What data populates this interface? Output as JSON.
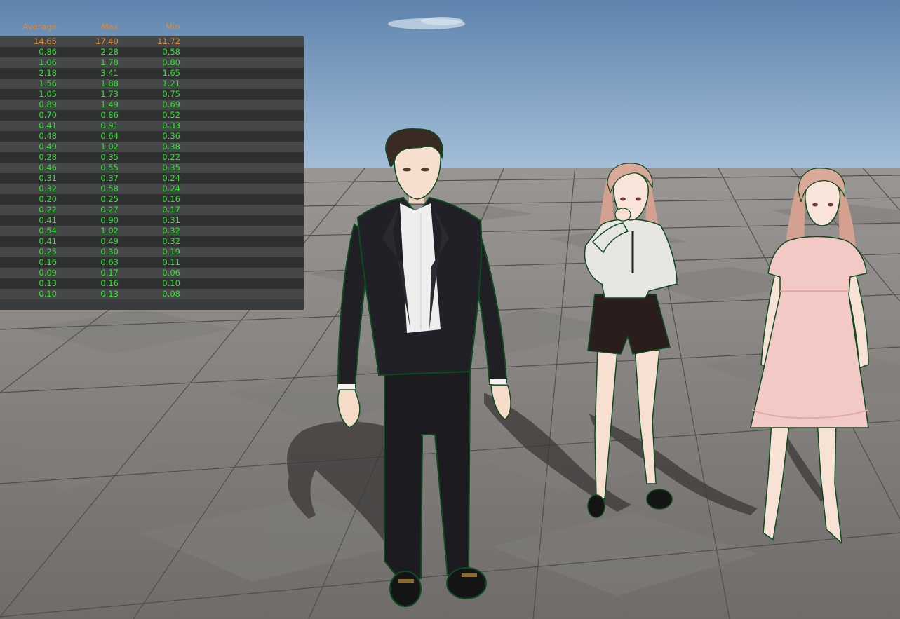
{
  "stats": {
    "headers": {
      "average": "Average",
      "max": "Max",
      "min": "Min"
    },
    "rows": [
      {
        "avg": "14.65",
        "max": "17.40",
        "min": "11.72"
      },
      {
        "avg": "0.86",
        "max": "2.28",
        "min": "0.58"
      },
      {
        "avg": "1.06",
        "max": "1.78",
        "min": "0.80"
      },
      {
        "avg": "2.18",
        "max": "3.41",
        "min": "1.65"
      },
      {
        "avg": "1.56",
        "max": "1.88",
        "min": "1.21"
      },
      {
        "avg": "1.05",
        "max": "1.73",
        "min": "0.75"
      },
      {
        "avg": "0.89",
        "max": "1.49",
        "min": "0.69"
      },
      {
        "avg": "0.70",
        "max": "0.86",
        "min": "0.52"
      },
      {
        "avg": "0.41",
        "max": "0.91",
        "min": "0.33"
      },
      {
        "avg": "0.48",
        "max": "0.64",
        "min": "0.36"
      },
      {
        "avg": "0.49",
        "max": "1.02",
        "min": "0.38"
      },
      {
        "avg": "0.28",
        "max": "0.35",
        "min": "0.22"
      },
      {
        "avg": "0.46",
        "max": "0.55",
        "min": "0.35"
      },
      {
        "avg": "0.31",
        "max": "0.37",
        "min": "0.24"
      },
      {
        "avg": "0.32",
        "max": "0.58",
        "min": "0.24"
      },
      {
        "avg": "0.20",
        "max": "0.25",
        "min": "0.16"
      },
      {
        "avg": "0.22",
        "max": "0.27",
        "min": "0.17"
      },
      {
        "avg": "0.41",
        "max": "0.90",
        "min": "0.31"
      },
      {
        "avg": "0.54",
        "max": "1.02",
        "min": "0.32"
      },
      {
        "avg": "0.41",
        "max": "0.49",
        "min": "0.32"
      },
      {
        "avg": "0.25",
        "max": "0.30",
        "min": "0.19"
      },
      {
        "avg": "0.16",
        "max": "0.63",
        "min": "0.11"
      },
      {
        "avg": "0.09",
        "max": "0.17",
        "min": "0.06"
      },
      {
        "avg": "0.13",
        "max": "0.16",
        "min": "0.10"
      },
      {
        "avg": "0.10",
        "max": "0.13",
        "min": "0.08"
      }
    ]
  },
  "scene": {
    "characters": [
      "man-in-black-suit",
      "woman-in-white-blouse-and-shorts",
      "woman-in-pink-dress"
    ],
    "colors": {
      "sky_top": "#5f84ad",
      "sky_bottom": "#a9c3dc",
      "floor_light": "#8f8c89",
      "floor_dark": "#75726f",
      "outline": "#0d4a1f",
      "header_orange": "#e08a2a",
      "value_green": "#2ee62e"
    }
  }
}
